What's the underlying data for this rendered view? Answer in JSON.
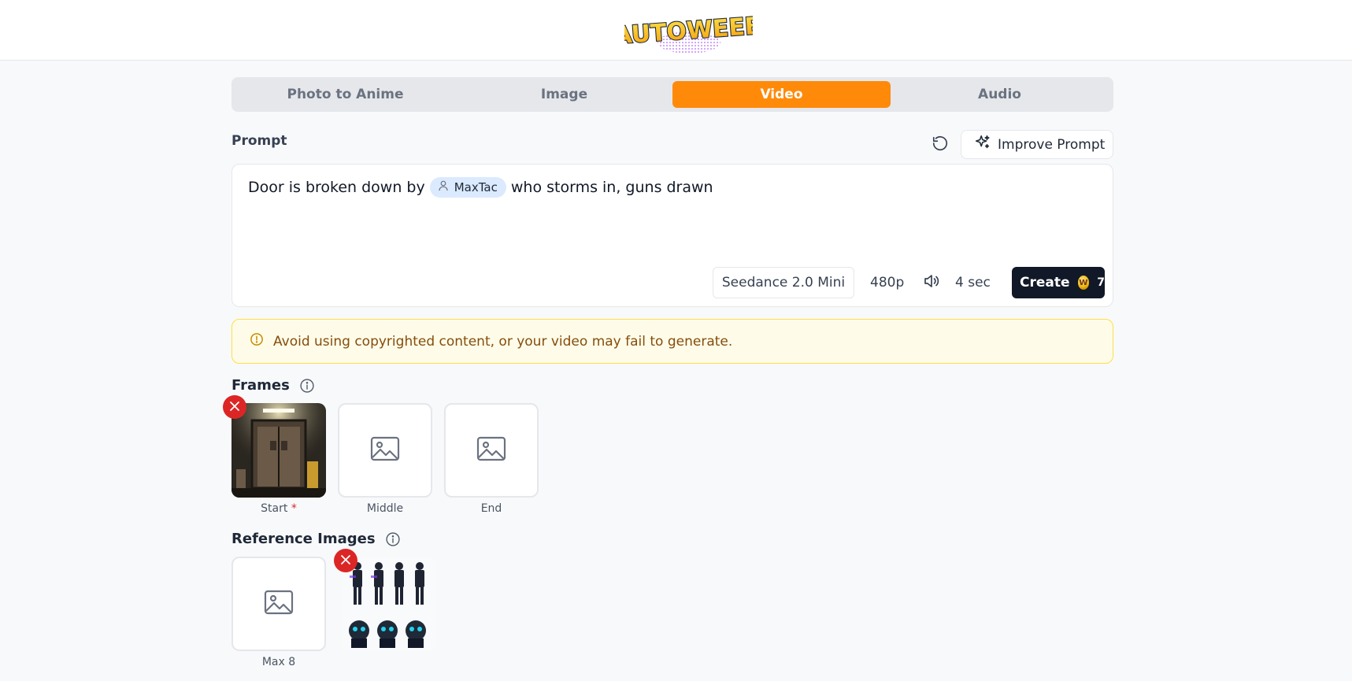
{
  "brand": {
    "logo_text": "AUTOWEEB"
  },
  "tabs": [
    {
      "label": "Photo to Anime"
    },
    {
      "label": "Image"
    },
    {
      "label": "Video"
    },
    {
      "label": "Audio"
    }
  ],
  "prompt": {
    "label": "Prompt",
    "improve_label": "Improve Prompt",
    "text_before": "Door is broken down by",
    "mention": "MaxTac",
    "text_after": "who storms in, guns drawn"
  },
  "controls": {
    "model": "Seedance 2.0 Mini",
    "resolution": "480p",
    "duration": "4 sec",
    "create_label": "Create",
    "cost": "7"
  },
  "warning": {
    "text": "Avoid using copyrighted content, or your video may fail to generate."
  },
  "frames": {
    "title": "Frames",
    "slots": [
      {
        "label": "Start",
        "required": "*"
      },
      {
        "label": "Middle"
      },
      {
        "label": "End"
      }
    ]
  },
  "reference": {
    "title": "Reference Images",
    "add_label": "Max 8"
  },
  "colors": {
    "accent": "#ff8a0a",
    "primary_button": "#111827",
    "danger": "#dc2626",
    "warning_bg": "#fefce8",
    "warning_border": "#fde047",
    "mention_bg": "#dbeafe"
  }
}
